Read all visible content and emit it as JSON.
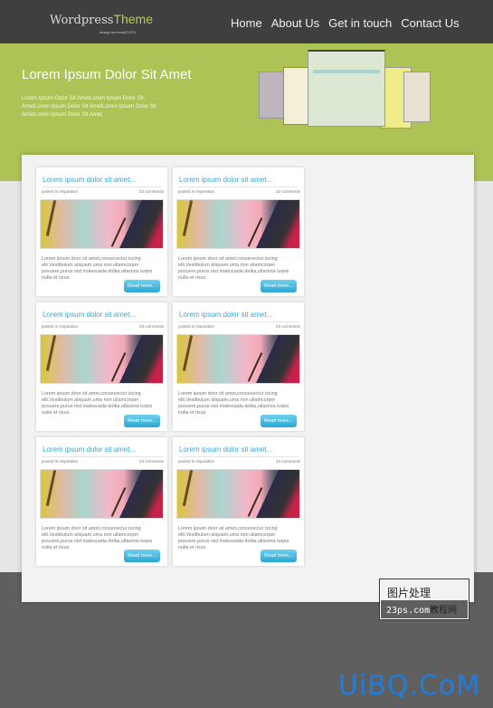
{
  "header": {
    "logo_main": "Wordpress",
    "logo_accent": "Theme",
    "tagline": "design by trendyTUTS",
    "nav": [
      "Home",
      "About Us",
      "Get in touch",
      "Contact Us"
    ]
  },
  "hero": {
    "title": "Lorem Ipsum Dolor Sit Amet",
    "text": "Lorem Ipsum Dolor Sit AmetLorem Ipsum Dolor Sit AmetLorem Ipsum Dolor Sit AmetLorem Ipsum Dolor Sit AmetLorem Ipsum Dolor Sit Amet"
  },
  "posts": [
    {
      "title": "Lorem ipsum dolor sit amet...",
      "meta": "posted in inspiration",
      "comments": "23 comments",
      "excerpt": "Lorem ipsum door sit amet,consecectur iscing elit.Vestibulum aliquam,uma non ullamcorper posuere,purus nisl malesuada dolka,utlacinia turpis nulla et risus.",
      "button": "Read more..."
    },
    {
      "title": "Lorem ipsum dolor sit amet...",
      "meta": "posted in inspiration",
      "comments": "23 comments",
      "excerpt": "Lorem ipsum door sit amet,consecectur iscing elit.Vestibulum aliquam,uma non ullamcorper posuere,purus nisl malesuada dolka,utlacinia turpis nulla et risus.",
      "button": "Read more..."
    },
    {
      "title": "Lorem ipsum dolor sit amet...",
      "meta": "posted in inspiration",
      "comments": "23 comments",
      "excerpt": "Lorem ipsum door sit amet,consecectur iscing elit.Vestibulum aliquam,uma non ullamcorper posuere,purus nisl malesuada dolka,utlacinia turpis nulla et risus.",
      "button": "Read more..."
    },
    {
      "title": "Lorem ipsum dolor sit amet...",
      "meta": "posted in inspiration",
      "comments": "23 comments",
      "excerpt": "Lorem ipsum door sit amet,consecectur iscing elit.Vestibulum aliquam,uma non ullamcorper posuere,purus nisl malesuada dolka,utlacinia turpis nulla et risus.",
      "button": "Read more..."
    },
    {
      "title": "Lorem ipsum dolor sit amet...",
      "meta": "posted in inspiration",
      "comments": "23 comments",
      "excerpt": "Lorem ipsum door sit amet,consecectur iscing elit.Vestibulum aliquam,uma non ullamcorper posuere,purus nisl malesuada dolka,utlacinia turpis nulla et risus.",
      "button": "Read more..."
    },
    {
      "title": "Lorem ipsum dolor sit amet...",
      "meta": "posted in inspiration",
      "comments": "23 comments",
      "excerpt": "Lorem ipsum door sit amet,consecectur iscing elit.Vestibulum aliquam,uma non ullamcorper posuere,purus nisl malesuada dolka,utlacinia turpis nulla et risus.",
      "button": "Read more..."
    }
  ],
  "watermark": {
    "line1": "图片处理",
    "line2": "23ps.com",
    "line3": "教程网",
    "site": "UiBQ.CoM"
  },
  "colors": {
    "header": "#3f3f3f",
    "accent_green": "#aec356",
    "link_blue": "#3aa6d0"
  }
}
